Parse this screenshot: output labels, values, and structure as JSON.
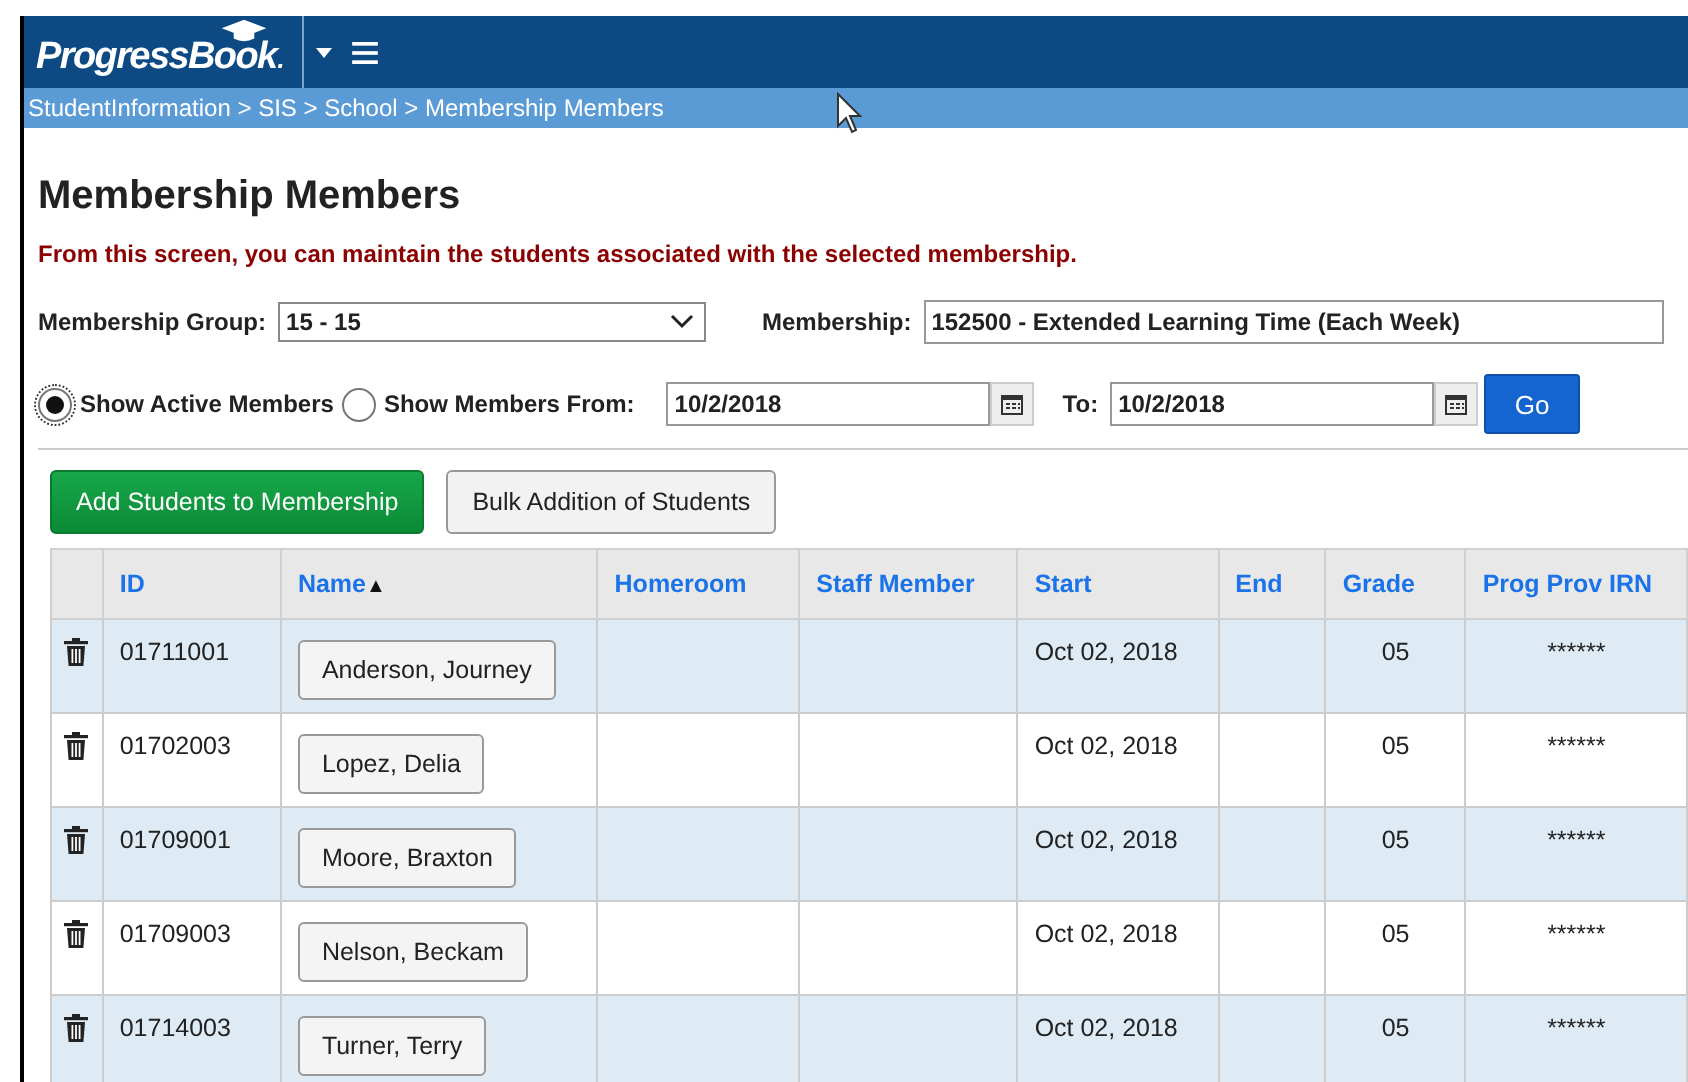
{
  "header": {
    "logo": "ProgressBook",
    "logo_suffix": "."
  },
  "breadcrumb": "StudentInformation > SIS > School > Membership Members",
  "title": "Membership Members",
  "description": "From this screen, you can maintain the students associated with the selected membership.",
  "filters": {
    "group_label": "Membership Group:",
    "group_value": "15 - 15",
    "membership_label": "Membership:",
    "membership_value": "152500 - Extended Learning Time (Each Week)"
  },
  "show_options": [
    {
      "label": "Show Active Members",
      "selected": true
    },
    {
      "label": "Show Members From:",
      "selected": false
    }
  ],
  "from_date": "10/2/2018",
  "to_label": "To:",
  "to_date": "10/2/2018",
  "go_button": "Go",
  "actions": [
    {
      "label": "Add Students to Membership",
      "kind": "primary"
    },
    {
      "label": "Bulk Addition of Students",
      "kind": "secondary"
    }
  ],
  "table": {
    "columns": [
      "ID",
      "Name",
      "Homeroom",
      "Staff Member",
      "Start",
      "End",
      "Grade",
      "Prog Prov IRN"
    ],
    "sort_marker": "▲",
    "rows": [
      {
        "id": "01711001",
        "name": "Anderson, Journey",
        "homeroom": "",
        "staff": "",
        "start": "Oct 02, 2018",
        "end": "",
        "grade": "05",
        "irn": "******"
      },
      {
        "id": "01702003",
        "name": "Lopez, Delia",
        "homeroom": "",
        "staff": "",
        "start": "Oct 02, 2018",
        "end": "",
        "grade": "05",
        "irn": "******"
      },
      {
        "id": "01709001",
        "name": "Moore, Braxton",
        "homeroom": "",
        "staff": "",
        "start": "Oct 02, 2018",
        "end": "",
        "grade": "05",
        "irn": "******"
      },
      {
        "id": "01709003",
        "name": "Nelson, Beckam",
        "homeroom": "",
        "staff": "",
        "start": "Oct 02, 2018",
        "end": "",
        "grade": "05",
        "irn": "******"
      },
      {
        "id": "01714003",
        "name": "Turner, Terry",
        "homeroom": "",
        "staff": "",
        "start": "Oct 02, 2018",
        "end": "",
        "grade": "05",
        "irn": "******"
      }
    ]
  }
}
